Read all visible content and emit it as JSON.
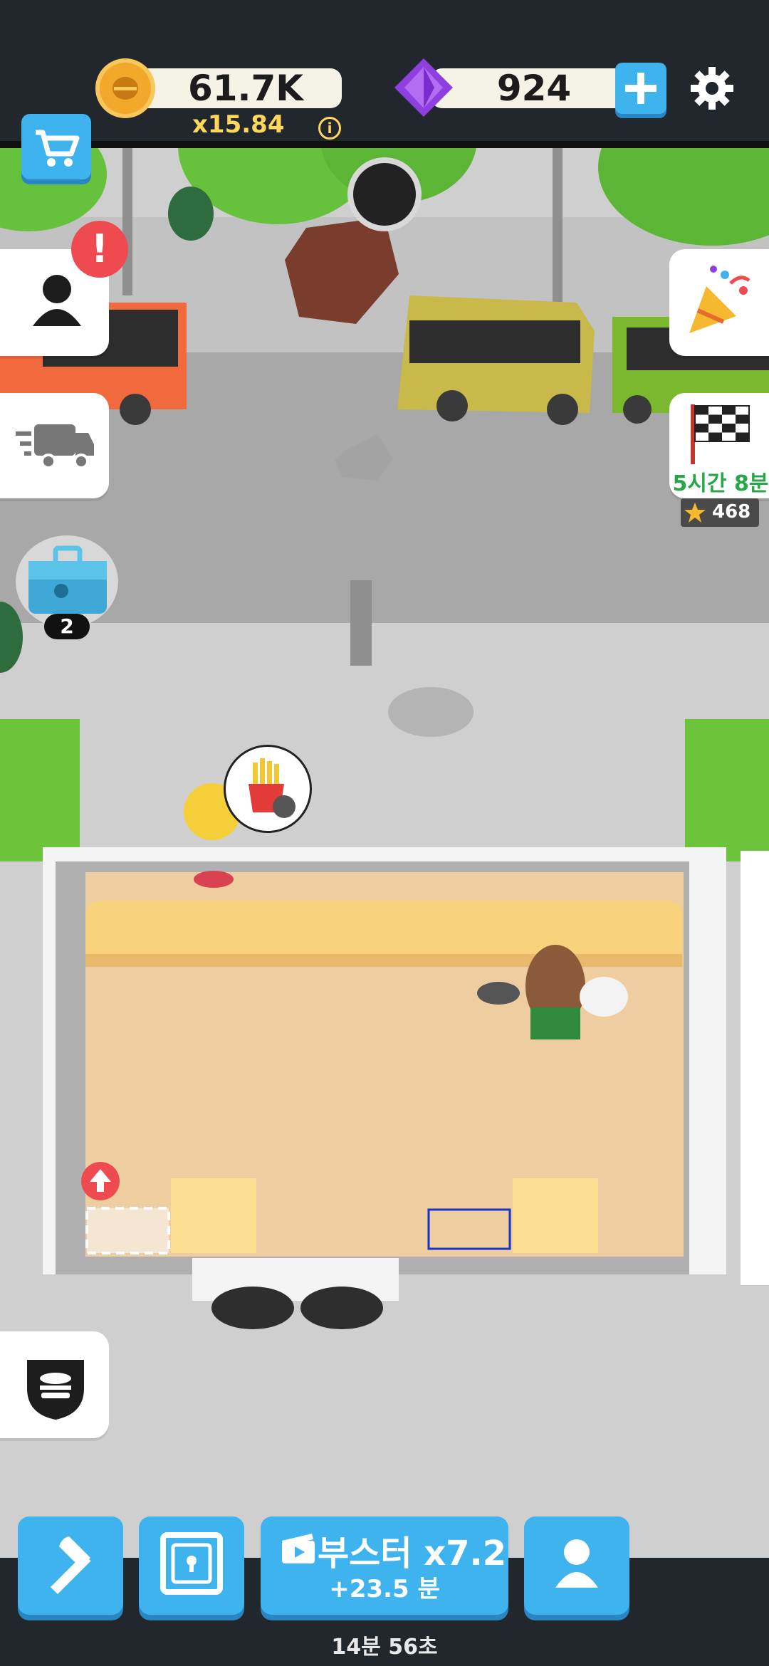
{
  "hud": {
    "coins": "61.7K",
    "multiplier": "x15.84",
    "gems": "924",
    "info_symbol": "i"
  },
  "side": {
    "alert_symbol": "!",
    "toolbox_count": "2",
    "event_timer": "5시간 8분",
    "stars": "468"
  },
  "bottom": {
    "booster_label": "부스터 x7.2",
    "booster_sub": "+23.5 분",
    "timer": "14분 56초"
  },
  "colors": {
    "hud_bg": "#22262d",
    "button_blue": "#3fb3ee",
    "coin_gold": "#f2a92b",
    "gem_purple": "#8d3fe0",
    "multiplier_yellow": "#ffd75a",
    "timer_green": "#2aa64a"
  }
}
